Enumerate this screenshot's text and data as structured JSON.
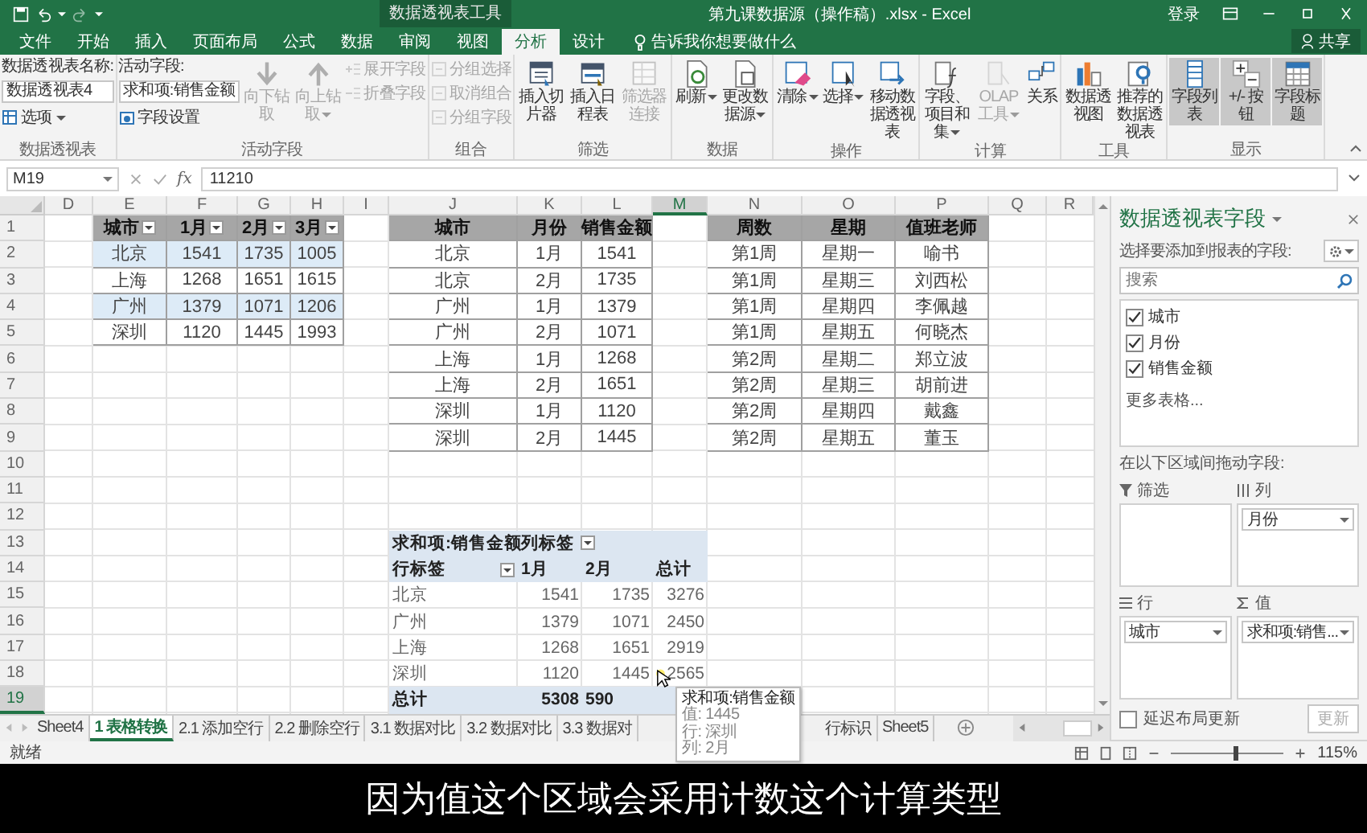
{
  "title_bar": {
    "contextual_label": "数据透视表工具",
    "title": "第九课数据源（操作稿）.xlsx - Excel",
    "sign_in": "登录"
  },
  "tabs": [
    {
      "label": "文件",
      "selected": false
    },
    {
      "label": "开始",
      "selected": false
    },
    {
      "label": "插入",
      "selected": false
    },
    {
      "label": "页面布局",
      "selected": false
    },
    {
      "label": "公式",
      "selected": false
    },
    {
      "label": "数据",
      "selected": false
    },
    {
      "label": "审阅",
      "selected": false
    },
    {
      "label": "视图",
      "selected": false
    },
    {
      "label": "分析",
      "selected": true
    },
    {
      "label": "设计",
      "selected": false
    }
  ],
  "tell_me": "告诉我你想要做什么",
  "share": "共享",
  "ribbon": {
    "groups": [
      {
        "label": "数据透视表",
        "columns": [
          [
            {
              "kind": "caption",
              "label": "数据透视表名称:"
            },
            {
              "kind": "input",
              "value": "数据透视表4"
            },
            {
              "kind": "small",
              "label": "选项",
              "disabled": false,
              "on": false,
              "caret": true
            }
          ]
        ]
      },
      {
        "label": "活动字段",
        "columns": [
          [
            {
              "kind": "caption",
              "label": "活动字段:"
            },
            {
              "kind": "input",
              "value": "求和项:销售金额"
            },
            {
              "kind": "small",
              "label": "字段设置",
              "disabled": false,
              "on": false,
              "caret": false
            }
          ],
          [
            {
              "kind": "large",
              "label": "向下钻取",
              "disabled": true,
              "on": false,
              "caret": false
            }
          ],
          [
            {
              "kind": "large",
              "label": "向上钻取",
              "disabled": true,
              "on": false,
              "caret": true
            }
          ],
          [
            {
              "kind": "small",
              "label": "展开字段",
              "disabled": true,
              "on": false,
              "caret": false
            },
            {
              "kind": "small",
              "label": "折叠字段",
              "disabled": true,
              "on": false,
              "caret": false
            }
          ]
        ]
      },
      {
        "label": "组合",
        "columns": [
          [
            {
              "kind": "small",
              "label": "分组选择",
              "disabled": true,
              "on": false,
              "caret": false
            },
            {
              "kind": "small",
              "label": "取消组合",
              "disabled": true,
              "on": false,
              "caret": false
            },
            {
              "kind": "small",
              "label": "分组字段",
              "disabled": true,
              "on": false,
              "caret": false
            }
          ]
        ]
      },
      {
        "label": "筛选",
        "columns": [
          [
            {
              "kind": "large",
              "label": "插入切片器",
              "disabled": false,
              "on": false,
              "caret": false
            }
          ],
          [
            {
              "kind": "large",
              "label": "插入日程表",
              "disabled": false,
              "on": false,
              "caret": false
            }
          ],
          [
            {
              "kind": "large",
              "label": "筛选器连接",
              "disabled": true,
              "on": false,
              "caret": false
            }
          ]
        ]
      },
      {
        "label": "数据",
        "columns": [
          [
            {
              "kind": "large",
              "label": "刷新",
              "disabled": false,
              "on": false,
              "caret": true
            }
          ],
          [
            {
              "kind": "large",
              "label": "更改数据源",
              "disabled": false,
              "on": false,
              "caret": true
            }
          ]
        ]
      },
      {
        "label": "操作",
        "columns": [
          [
            {
              "kind": "large",
              "label": "清除",
              "disabled": false,
              "on": false,
              "caret": true
            }
          ],
          [
            {
              "kind": "large",
              "label": "选择",
              "disabled": false,
              "on": false,
              "caret": true
            }
          ],
          [
            {
              "kind": "large",
              "label": "移动数据透视表",
              "disabled": false,
              "on": false,
              "caret": false
            }
          ]
        ]
      },
      {
        "label": "计算",
        "columns": [
          [
            {
              "kind": "large",
              "label": "字段、项目和集",
              "disabled": false,
              "on": false,
              "caret": true
            }
          ],
          [
            {
              "kind": "large",
              "label": "OLAP 工具",
              "disabled": true,
              "on": false,
              "caret": true
            }
          ],
          [
            {
              "kind": "large",
              "label": "关系",
              "disabled": false,
              "on": false,
              "caret": false
            }
          ]
        ]
      },
      {
        "label": "工具",
        "columns": [
          [
            {
              "kind": "large",
              "label": "数据透视图",
              "disabled": false,
              "on": false,
              "caret": false
            }
          ],
          [
            {
              "kind": "large",
              "label": "推荐的数据透视表",
              "disabled": false,
              "on": false,
              "caret": false
            }
          ]
        ]
      },
      {
        "label": "显示",
        "columns": [
          [
            {
              "kind": "large",
              "label": "字段列表",
              "disabled": false,
              "on": true,
              "caret": false
            }
          ],
          [
            {
              "kind": "large",
              "label": "+/- 按钮",
              "disabled": false,
              "on": true,
              "caret": false
            }
          ],
          [
            {
              "kind": "large",
              "label": "字段标题",
              "disabled": false,
              "on": true,
              "caret": false
            }
          ]
        ]
      }
    ]
  },
  "formula_bar": {
    "name_box": "M19",
    "function_label": "fx",
    "value": "11210"
  },
  "sheet": {
    "columns": [
      {
        "label": "D",
        "selected": false
      },
      {
        "label": "E",
        "selected": false
      },
      {
        "label": "F",
        "selected": false
      },
      {
        "label": "G",
        "selected": false
      },
      {
        "label": "H",
        "selected": false
      },
      {
        "label": "I",
        "selected": false
      },
      {
        "label": "J",
        "selected": false
      },
      {
        "label": "K",
        "selected": false
      },
      {
        "label": "L",
        "selected": false
      },
      {
        "label": "M",
        "selected": true
      },
      {
        "label": "N",
        "selected": false
      },
      {
        "label": "O",
        "selected": false
      },
      {
        "label": "P",
        "selected": false
      },
      {
        "label": "Q",
        "selected": false
      },
      {
        "label": "R",
        "selected": false
      }
    ],
    "rows": [
      {
        "label": "1",
        "selected": false
      },
      {
        "label": "2",
        "selected": false
      },
      {
        "label": "3",
        "selected": false
      },
      {
        "label": "4",
        "selected": false
      },
      {
        "label": "5",
        "selected": false
      },
      {
        "label": "6",
        "selected": false
      },
      {
        "label": "7",
        "selected": false
      },
      {
        "label": "8",
        "selected": false
      },
      {
        "label": "9",
        "selected": false
      },
      {
        "label": "10",
        "selected": false
      },
      {
        "label": "11",
        "selected": false
      },
      {
        "label": "12",
        "selected": false
      },
      {
        "label": "13",
        "selected": false
      },
      {
        "label": "14",
        "selected": false
      },
      {
        "label": "15",
        "selected": false
      },
      {
        "label": "16",
        "selected": false
      },
      {
        "label": "17",
        "selected": false
      },
      {
        "label": "18",
        "selected": false
      },
      {
        "label": "19",
        "selected": true
      }
    ],
    "tables": [
      {
        "banded": true,
        "header": [
          {
            "text": "城市",
            "filter": true
          },
          {
            "text": "1月",
            "filter": true
          },
          {
            "text": "2月",
            "filter": true
          },
          {
            "text": "3月",
            "filter": true
          }
        ],
        "rows": [
          [
            "北京",
            "1541",
            "1735",
            "1005"
          ],
          [
            "上海",
            "1268",
            "1651",
            "1615"
          ],
          [
            "广州",
            "1379",
            "1071",
            "1206"
          ],
          [
            "深圳",
            "1120",
            "1445",
            "1993"
          ]
        ]
      },
      {
        "banded": false,
        "header": [
          {
            "text": "城市",
            "filter": false
          },
          {
            "text": "月份",
            "filter": false
          },
          {
            "text": "销售金额",
            "filter": false
          }
        ],
        "rows": [
          [
            "北京",
            "1月",
            "1541"
          ],
          [
            "北京",
            "2月",
            "1735"
          ],
          [
            "广州",
            "1月",
            "1379"
          ],
          [
            "广州",
            "2月",
            "1071"
          ],
          [
            "上海",
            "1月",
            "1268"
          ],
          [
            "上海",
            "2月",
            "1651"
          ],
          [
            "深圳",
            "1月",
            "1120"
          ],
          [
            "深圳",
            "2月",
            "1445"
          ]
        ]
      },
      {
        "banded": false,
        "header": [
          {
            "text": "周数",
            "filter": false
          },
          {
            "text": "星期",
            "filter": false
          },
          {
            "text": "值班老师",
            "filter": false
          }
        ],
        "rows": [
          [
            "第1周",
            "星期一",
            "喻书"
          ],
          [
            "第1周",
            "星期三",
            "刘西松"
          ],
          [
            "第1周",
            "星期四",
            "李佩越"
          ],
          [
            "第1周",
            "星期五",
            "何晓杰"
          ],
          [
            "第2周",
            "星期二",
            "郑立波"
          ],
          [
            "第2周",
            "星期三",
            "胡前进"
          ],
          [
            "第2周",
            "星期四",
            "戴鑫"
          ],
          [
            "第2周",
            "星期五",
            "董玉"
          ]
        ]
      }
    ],
    "pivot": {
      "title": "求和项:销售金额",
      "column_label": "列标签",
      "row_label": "行标签",
      "columns": [
        "1月",
        "2月",
        "总计"
      ],
      "rows": [
        {
          "label": "北京",
          "values": [
            "1541",
            "1735",
            "3276"
          ]
        },
        {
          "label": "广州",
          "values": [
            "1379",
            "1071",
            "2450"
          ]
        },
        {
          "label": "上海",
          "values": [
            "1268",
            "1651",
            "2919"
          ]
        },
        {
          "label": "深圳",
          "values": [
            "1120",
            "1445",
            "2565"
          ]
        }
      ],
      "total": {
        "label": "总计",
        "values": [
          "5308",
          "590"
        ]
      }
    },
    "tooltip": {
      "title": "求和项:销售金额",
      "lines": [
        "值: 1445",
        "行: 深圳",
        "列: 2月"
      ]
    }
  },
  "sheet_tabs": [
    {
      "label": "Sheet4",
      "selected": false
    },
    {
      "label": "1 表格转换",
      "selected": true
    },
    {
      "label": "2.1 添加空行",
      "selected": false
    },
    {
      "label": "2.2 删除空行",
      "selected": false
    },
    {
      "label": "3.1 数据对比",
      "selected": false
    },
    {
      "label": "3.2 数据对比",
      "selected": false
    },
    {
      "label": "3.3 数据对",
      "selected": false
    },
    {
      "label": "行标识",
      "selected": false
    },
    {
      "label": "Sheet5",
      "selected": false
    }
  ],
  "field_pane": {
    "title": "数据透视表字段",
    "prompt": "选择要添加到报表的字段:",
    "search_placeholder": "搜索",
    "fields": [
      {
        "label": "城市",
        "checked": true
      },
      {
        "label": "月份",
        "checked": true
      },
      {
        "label": "销售金额",
        "checked": true
      }
    ],
    "more": "更多表格...",
    "areas_prompt": "在以下区域间拖动字段:",
    "areas": [
      {
        "label": "筛选"
      },
      {
        "label": "列",
        "chips": [
          "月份"
        ]
      },
      {
        "label": "行",
        "chips": [
          "城市"
        ]
      },
      {
        "label": "值",
        "chips": [
          "求和项:销售..."
        ]
      }
    ],
    "defer": {
      "label": "延迟布局更新",
      "checked": false
    },
    "update": {
      "label": "更新",
      "disabled": true
    }
  },
  "status_bar": {
    "status": "就绪",
    "zoom": {
      "label": "115%",
      "level": 0.55
    }
  },
  "subtitle": "因为值这个区域会采用计数这个计算类型"
}
